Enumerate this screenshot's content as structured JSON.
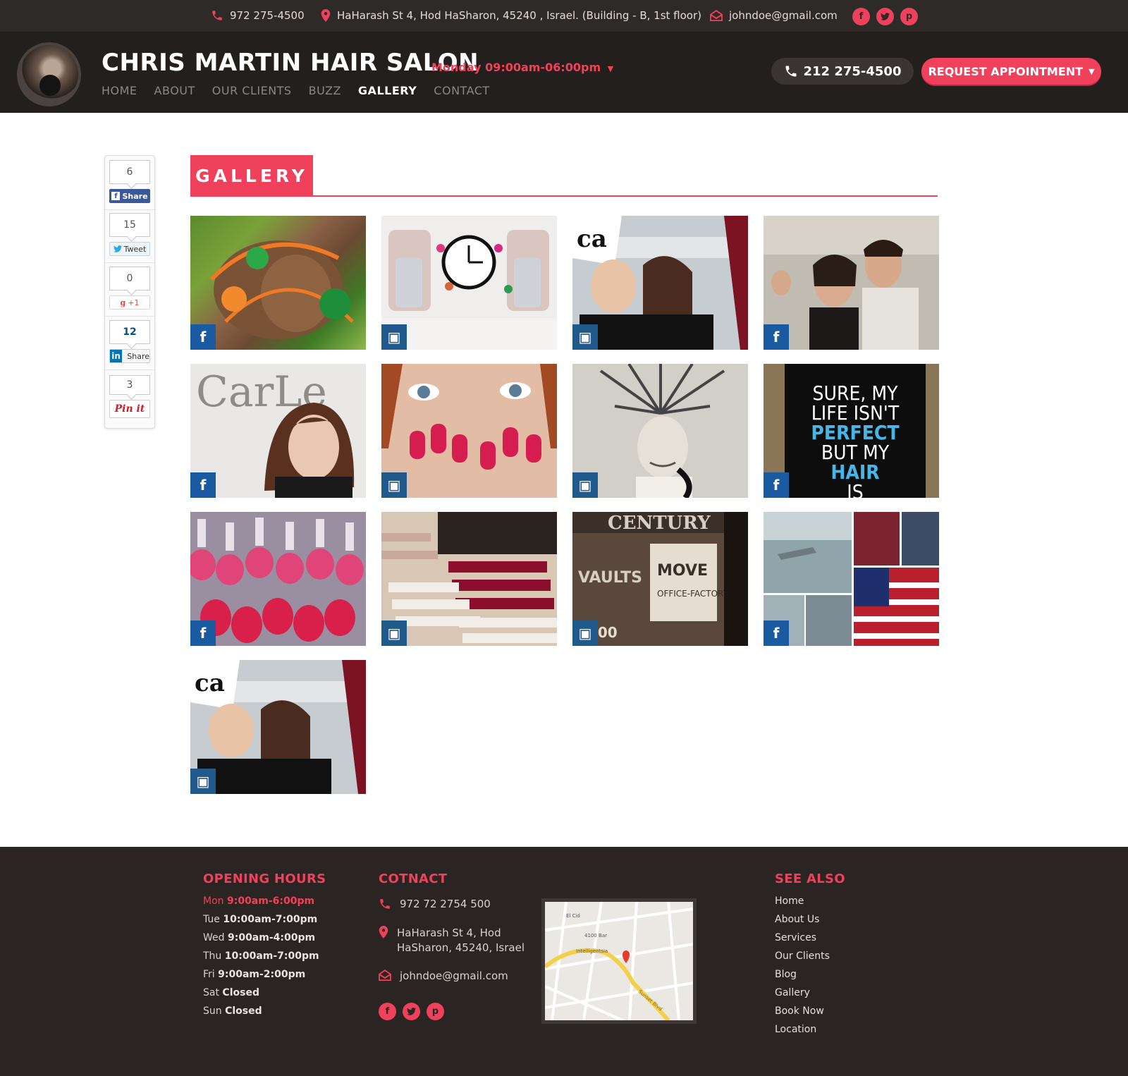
{
  "topbar": {
    "phone": "972 275-4500",
    "address": "HaHarash St 4, Hod HaSharon, 45240 , Israel. (Building - B, 1st floor)",
    "email": "johndoe@gmail.com",
    "social": [
      "facebook-icon",
      "twitter-icon",
      "pinterest-icon"
    ]
  },
  "header": {
    "title": "CHRIS MARTIN HAIR SALON",
    "hours": "Monday 09:00am-06:00pm",
    "nav": [
      {
        "label": "HOME"
      },
      {
        "label": "ABOUT"
      },
      {
        "label": "OUR CLIENTS"
      },
      {
        "label": "BUZZ"
      },
      {
        "label": "GALLERY",
        "active": true
      },
      {
        "label": "CONTACT"
      }
    ],
    "phone_button": "212 275-4500",
    "request_button": "REQUEST APPOINTMENT"
  },
  "share": {
    "facebook": {
      "count": "6",
      "label": "Share"
    },
    "twitter": {
      "count": "15",
      "label": "Tweet"
    },
    "google": {
      "count": "0",
      "label": "+1"
    },
    "linkedin": {
      "count": "12",
      "label": "Share"
    },
    "pinterest": {
      "count": "3",
      "label": "Pin it"
    }
  },
  "gallery": {
    "title": "GALLERY",
    "tiles": [
      {
        "source": "facebook",
        "subject": "hair-bows"
      },
      {
        "source": "instagram",
        "subject": "nail-polish-ad"
      },
      {
        "source": "instagram",
        "subject": "salon-selfie"
      },
      {
        "source": "facebook",
        "subject": "party-photo"
      },
      {
        "source": "facebook",
        "subject": "stylist-portrait"
      },
      {
        "source": "instagram",
        "subject": "pink-nails"
      },
      {
        "source": "instagram",
        "subject": "vintage-perm"
      },
      {
        "source": "facebook",
        "subject": "quote-poster"
      },
      {
        "source": "facebook",
        "subject": "nail-polish-bottles"
      },
      {
        "source": "instagram",
        "subject": "polish-display"
      },
      {
        "source": "instagram",
        "subject": "vintage-sign"
      },
      {
        "source": "facebook",
        "subject": "flag-collage"
      },
      {
        "source": "instagram",
        "subject": "salon-selfie"
      }
    ],
    "quote_lines": [
      "SURE, MY",
      "LIFE ISN'T",
      "PERFECT",
      "BUT MY",
      "HAIR",
      "IS"
    ]
  },
  "footer": {
    "hours_title": "OPENING HOURS",
    "hours": [
      {
        "day": "Mon",
        "time": "9:00am-6:00pm",
        "today": true
      },
      {
        "day": "Tue",
        "time": "10:00am-7:00pm"
      },
      {
        "day": "Wed",
        "time": "9:00am-4:00pm"
      },
      {
        "day": "Thu",
        "time": "10:00am-7:00pm"
      },
      {
        "day": "Fri",
        "time": "9:00am-2:00pm"
      },
      {
        "day": "Sat",
        "time": "Closed"
      },
      {
        "day": "Sun",
        "time": "Closed"
      }
    ],
    "contact_title": "COTNACT",
    "contact_phone": "972 72 2754 500",
    "contact_address_1": "HaHarash St 4, Hod",
    "contact_address_2": "HaSharon, 45240, Israel",
    "contact_email": "johndoe@gmail.com",
    "map_labels": {
      "street": "Sunset Blvd",
      "place_1": "Intelligentsia",
      "place_2": "4100 Bar",
      "place_3": "El Cid"
    },
    "see_also_title": "SEE ALSO",
    "links": [
      "Home",
      "About Us",
      "Services",
      "Our Clients",
      "Blog",
      "Gallery",
      "Book Now",
      "Location"
    ]
  },
  "colors": {
    "accent": "#f0415c",
    "dark": "#231f1d",
    "topbar": "#2e2a28",
    "footer": "#2a2523"
  }
}
